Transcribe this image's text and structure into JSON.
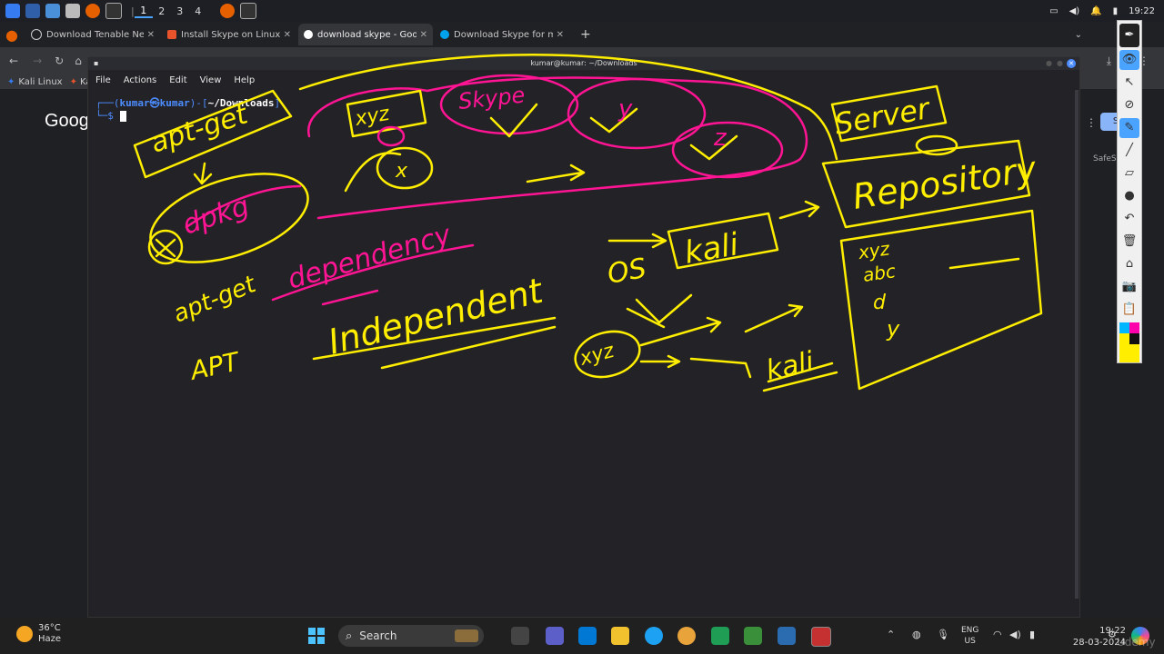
{
  "kali_panel": {
    "workspaces": [
      "1",
      "2",
      "3",
      "4"
    ],
    "active_workspace": "1",
    "time": "19:22"
  },
  "browser": {
    "tabs": [
      {
        "label": "Download Tenable Nessus",
        "active": false,
        "color": "#cccccc"
      },
      {
        "label": "Install Skype on Linux | Sn",
        "active": false,
        "color": "#e8532b"
      },
      {
        "label": "download skype - Google",
        "active": true,
        "color": "#ffffff"
      },
      {
        "label": "Download Skype for mob",
        "active": false,
        "color": "#00a2ed"
      }
    ],
    "new_tab": "+",
    "bookmarks": [
      "Kali Linux",
      "Ka"
    ],
    "google_logo": "Goog",
    "right_button": "S",
    "safesearch": "SafeS"
  },
  "terminal": {
    "title": "kumar@kumar: ~/Downloads",
    "menu": [
      "File",
      "Actions",
      "Edit",
      "View",
      "Help"
    ],
    "prompt_open": "┌──(",
    "user": "kumar㉿kumar",
    "prompt_mid": ")-[",
    "dir": "~/Downloads",
    "prompt_close": "]",
    "prompt_line2": "└─$ "
  },
  "annotation_tools": {
    "colors": [
      "#00b7ff",
      "#ff00aa",
      "#ffee00",
      "#111111",
      "#ffee00"
    ]
  },
  "handwriting": {
    "apt_get": "apt-get",
    "xyz": "xyz",
    "skype": "Skype",
    "x": "x",
    "y": "y",
    "z": "z",
    "dpkg": "dpkg",
    "dependency": "dependency",
    "apt_get_cursive": "apt-get",
    "apt": "APT",
    "independent": "Independent",
    "os": "OS",
    "kali": "kali",
    "kali2": "kali",
    "server": "Server",
    "repository": "Repository",
    "repo_items": [
      "xyz",
      "abc",
      "d",
      "y"
    ],
    "xyz2": "xyz"
  },
  "taskbar": {
    "temperature": "36°C",
    "condition": "Haze",
    "search_placeholder": "Search",
    "lang1": "ENG",
    "lang2": "US",
    "time": "19:22",
    "date": "28-03-2024",
    "watermark": "Udemy"
  }
}
